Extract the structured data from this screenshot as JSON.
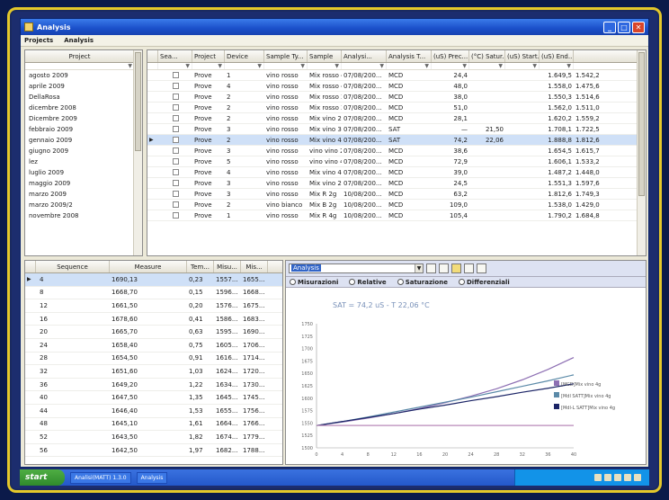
{
  "window": {
    "title": "Analysis"
  },
  "menu": [
    "Projects",
    "Analysis"
  ],
  "projects": {
    "header": "Project",
    "items": [
      "agosto 2009",
      "aprile 2009",
      "DellaRosa",
      "dicembre 2008",
      "Dicembre 2009",
      "febbraio 2009",
      "gennaio 2009",
      "giugno 2009",
      "lez",
      "luglio 2009",
      "maggio 2009",
      "marzo 2009",
      "marzo 2009/2",
      "novembre 2008"
    ]
  },
  "samples": {
    "columns": [
      "Sea...",
      "Project",
      "Device",
      "Sample Ty...",
      "Sample",
      "Analysi...",
      "Analysis T...",
      "(uS) Prec...",
      "(°C) Satur...",
      "(uS) Start...",
      "(uS) End..."
    ],
    "rows": [
      {
        "project": "Prove",
        "device": "1",
        "type": "vino rosso",
        "sample": "Mix rosso 4g",
        "date": "07/08/200...",
        "atype": "MCD",
        "prec": "24,4",
        "sat1": "",
        "sat2": "",
        "start": "1.649,5",
        "end": "1.542,2"
      },
      {
        "project": "Prove",
        "device": "4",
        "type": "vino rosso",
        "sample": "Mix rosso 4g",
        "date": "07/08/200...",
        "atype": "MCD",
        "prec": "48,0",
        "sat1": "",
        "sat2": "",
        "start": "1.558,0",
        "end": "1.475,6"
      },
      {
        "project": "Prove",
        "device": "2",
        "type": "vino rosso",
        "sample": "Mix rosso 2g",
        "date": "07/08/200...",
        "atype": "MCD",
        "prec": "38,0",
        "sat1": "",
        "sat2": "",
        "start": "1.550,3",
        "end": "1.514,6"
      },
      {
        "project": "Prove",
        "device": "2",
        "type": "vino rosso",
        "sample": "Mix rosso 2g",
        "date": "07/08/200...",
        "atype": "MCD",
        "prec": "51,0",
        "sat1": "",
        "sat2": "",
        "start": "1.562,0",
        "end": "1.511,0"
      },
      {
        "project": "Prove",
        "device": "2",
        "type": "vino rosso",
        "sample": "Mix vino 2g",
        "date": "07/08/200...",
        "atype": "MCD",
        "prec": "28,1",
        "sat1": "",
        "sat2": "",
        "start": "1.620,2",
        "end": "1.559,2"
      },
      {
        "project": "Prove",
        "device": "3",
        "type": "vino rosso",
        "sample": "Mix vino 3g",
        "date": "07/08/200...",
        "atype": "SAT",
        "prec": "—",
        "sat1": "21,50",
        "sat2": "",
        "start": "1.708,1",
        "end": "1.722,5"
      },
      {
        "project": "Prove",
        "device": "2",
        "type": "vino rosso",
        "sample": "Mix vino 4g",
        "date": "07/08/200...",
        "atype": "SAT",
        "prec": "74,2",
        "sat1": "22,06",
        "sat2": "",
        "start": "1.888,8",
        "end": "1.812,6",
        "selected": true
      },
      {
        "project": "Prove",
        "device": "3",
        "type": "vino rosso",
        "sample": "vino vino 2",
        "date": "07/08/200...",
        "atype": "MCD",
        "prec": "38,6",
        "sat1": "",
        "sat2": "",
        "start": "1.654,5",
        "end": "1.615,7"
      },
      {
        "project": "Prove",
        "device": "5",
        "type": "vino rosso",
        "sample": "vino vino 4",
        "date": "07/08/200...",
        "atype": "MCD",
        "prec": "72,9",
        "sat1": "",
        "sat2": "",
        "start": "1.606,1",
        "end": "1.533,2"
      },
      {
        "project": "Prove",
        "device": "4",
        "type": "vino rosso",
        "sample": "Mix vino 4g",
        "date": "07/08/200...",
        "atype": "MCD",
        "prec": "39,0",
        "sat1": "",
        "sat2": "",
        "start": "1.487,2",
        "end": "1.448,0"
      },
      {
        "project": "Prove",
        "device": "3",
        "type": "vino rosso",
        "sample": "Mix vino 2g",
        "date": "07/08/200...",
        "atype": "MCD",
        "prec": "24,5",
        "sat1": "",
        "sat2": "",
        "start": "1.551,3",
        "end": "1.597,6"
      },
      {
        "project": "Prove",
        "device": "3",
        "type": "vino rosso",
        "sample": "Mix R 2g",
        "date": "10/08/200...",
        "atype": "MCD",
        "prec": "63,2",
        "sat1": "",
        "sat2": "",
        "start": "1.812,6",
        "end": "1.749,3"
      },
      {
        "project": "Prove",
        "device": "2",
        "type": "vino bianco",
        "sample": "Mix B 2g",
        "date": "10/08/200...",
        "atype": "MCD",
        "prec": "109,0",
        "sat1": "",
        "sat2": "",
        "start": "1.538,0",
        "end": "1.429,0"
      },
      {
        "project": "Prove",
        "device": "1",
        "type": "vino rosso",
        "sample": "Mix R 4g",
        "date": "10/08/200...",
        "atype": "MCD",
        "prec": "105,4",
        "sat1": "",
        "sat2": "",
        "start": "1.790,2",
        "end": "1.684,8"
      }
    ]
  },
  "sequence": {
    "columns": [
      "Sequence",
      "Measure",
      "Tem...",
      "Misu...",
      "Mis..."
    ],
    "rows": [
      [
        "4",
        "1690,13",
        "0,23",
        "1557...",
        "1655..."
      ],
      [
        "8",
        "1668,70",
        "0,15",
        "1596...",
        "1668..."
      ],
      [
        "12",
        "1661,50",
        "0,20",
        "1576...",
        "1675..."
      ],
      [
        "16",
        "1678,60",
        "0,41",
        "1586...",
        "1683..."
      ],
      [
        "20",
        "1665,70",
        "0,63",
        "1595...",
        "1690..."
      ],
      [
        "24",
        "1658,40",
        "0,75",
        "1605...",
        "1706..."
      ],
      [
        "28",
        "1654,50",
        "0,91",
        "1616...",
        "1714..."
      ],
      [
        "32",
        "1651,60",
        "1,03",
        "1624...",
        "1720..."
      ],
      [
        "36",
        "1649,20",
        "1,22",
        "1634...",
        "1730..."
      ],
      [
        "40",
        "1647,50",
        "1,35",
        "1645...",
        "1745..."
      ],
      [
        "44",
        "1646,40",
        "1,53",
        "1655...",
        "1756..."
      ],
      [
        "48",
        "1645,10",
        "1,61",
        "1664...",
        "1766..."
      ],
      [
        "52",
        "1643,50",
        "1,82",
        "1674...",
        "1779..."
      ],
      [
        "56",
        "1642,50",
        "1,97",
        "1682...",
        "1788..."
      ]
    ]
  },
  "chart_toolbar": {
    "combo_value": "Analysis",
    "radios": [
      "Misurazioni",
      "Relative",
      "Saturazione",
      "Differenziali"
    ]
  },
  "chart_data": {
    "type": "line",
    "title": "SAT = 74,2 uS - T 22,06 °C",
    "x": [
      0,
      4,
      8,
      12,
      16,
      20,
      24,
      28,
      32,
      36,
      40
    ],
    "xlabel": "",
    "ylabel": "",
    "ylim": [
      1500,
      1750
    ],
    "ytick_labels": [
      "1750",
      "1725",
      "1700",
      "1675",
      "1650",
      "1625",
      "1600",
      "1575",
      "1550",
      "1525",
      "1500"
    ],
    "series": [
      {
        "name": "[MCD]Mix vino 4g",
        "color": "#8d6fb3",
        "values": [
          1545,
          1552,
          1560,
          1569,
          1579,
          1591,
          1604,
          1619,
          1637,
          1658,
          1682
        ]
      },
      {
        "name": "[Mdl SATT]Mix vino 4g",
        "color": "#5b8aa8",
        "values": [
          1545,
          1553,
          1562,
          1572,
          1582,
          1592,
          1602,
          1613,
          1624,
          1635,
          1647
        ]
      },
      {
        "name": "[Mdl-L SATT]Mix vino 4g",
        "color": "#1b2466",
        "values": [
          1545,
          1553,
          1561,
          1569,
          1578,
          1586,
          1595,
          1603,
          1612,
          1620,
          1629
        ]
      },
      {
        "name": "",
        "color": "#b88ab8",
        "values": [
          1545,
          1545,
          1545,
          1545,
          1545,
          1545,
          1545,
          1545,
          1545,
          1545,
          1545
        ]
      }
    ]
  },
  "taskbar": {
    "start": "start",
    "tasks": [
      "Analisi(MATT) 1.3.0",
      "Analysis"
    ],
    "clock": ""
  }
}
